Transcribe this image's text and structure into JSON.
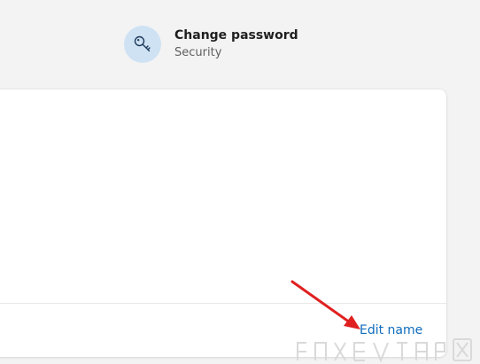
{
  "change_password": {
    "title": "Change password",
    "subtitle": "Security",
    "icon": "key-icon"
  },
  "card": {
    "edit_link_label": "Edit name"
  },
  "colors": {
    "page_background": "#f3f3f3",
    "icon_circle": "#cfe2f4",
    "link": "#0f6cbd",
    "annotation": "#e01f1f"
  }
}
